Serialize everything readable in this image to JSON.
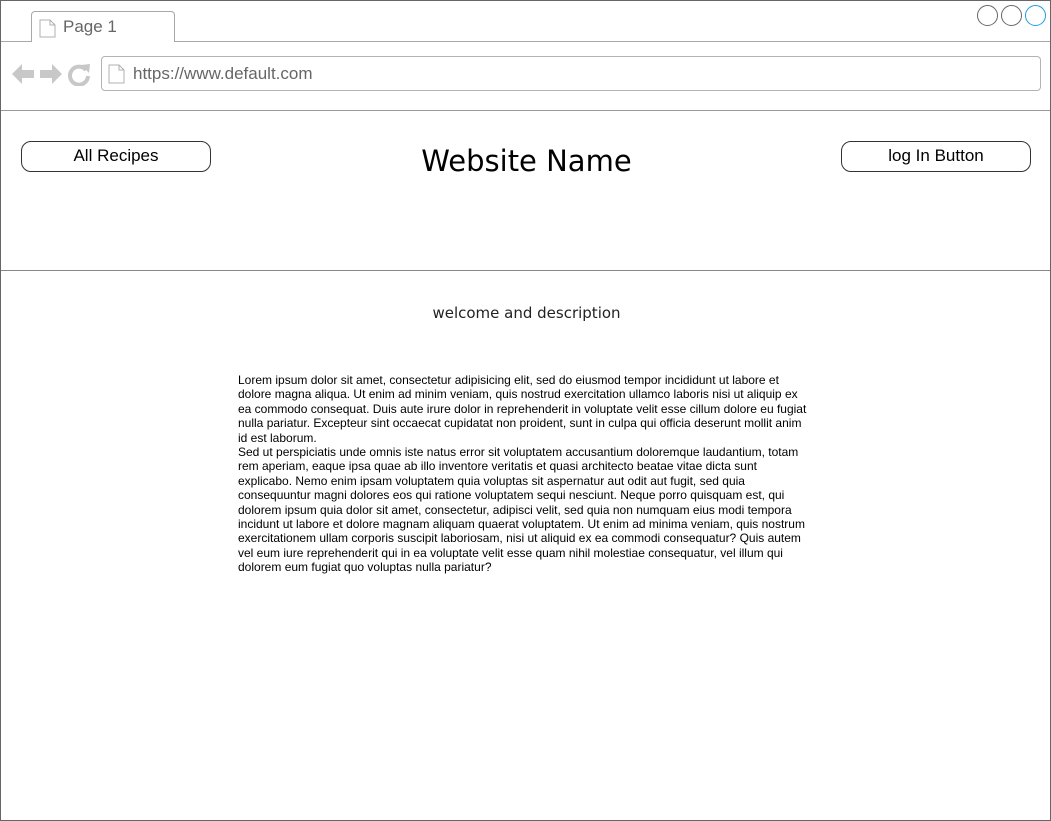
{
  "browser": {
    "tab_label": "Page 1",
    "url": "https://www.default.com",
    "window_controls": [
      "minimize",
      "maximize",
      "close"
    ]
  },
  "header": {
    "left_button": "All Recipes",
    "site_title": "Website Name",
    "right_button": "log In Button"
  },
  "content": {
    "welcome": "welcome and description",
    "paragraphs": [
      "Lorem ipsum dolor sit amet, consectetur adipisicing elit, sed do eiusmod tempor incididunt ut labore et dolore magna aliqua. Ut enim ad minim veniam, quis nostrud exercitation ullamco laboris nisi ut aliquip ex ea commodo consequat. Duis aute irure dolor in reprehenderit in voluptate velit esse cillum dolore eu fugiat nulla pariatur. Excepteur sint occaecat cupidatat non proident, sunt in culpa qui officia deserunt mollit anim id est laborum.",
      "Sed ut perspiciatis unde omnis iste natus error sit voluptatem accusantium doloremque laudantium, totam rem aperiam, eaque ipsa quae ab illo inventore veritatis et quasi architecto beatae vitae dicta sunt explicabo. Nemo enim ipsam voluptatem quia voluptas sit aspernatur aut odit aut fugit, sed quia consequuntur magni dolores eos qui ratione voluptatem sequi nesciunt. Neque porro quisquam est, qui dolorem ipsum quia dolor sit amet, consectetur, adipisci velit, sed quia non numquam eius modi tempora incidunt ut labore et dolore magnam aliquam quaerat voluptatem. Ut enim ad minima veniam, quis nostrum exercitationem ullam corporis suscipit laboriosam, nisi ut aliquid ex ea commodi consequatur? Quis autem vel eum iure reprehenderit qui in ea voluptate velit esse quam nihil molestiae consequatur, vel illum qui dolorem eum fugiat quo voluptas nulla pariatur?"
    ]
  },
  "colors": {
    "frame_border": "#666666",
    "chrome_icon": "#c8c8c8",
    "active_control": "#1a9fd9"
  }
}
